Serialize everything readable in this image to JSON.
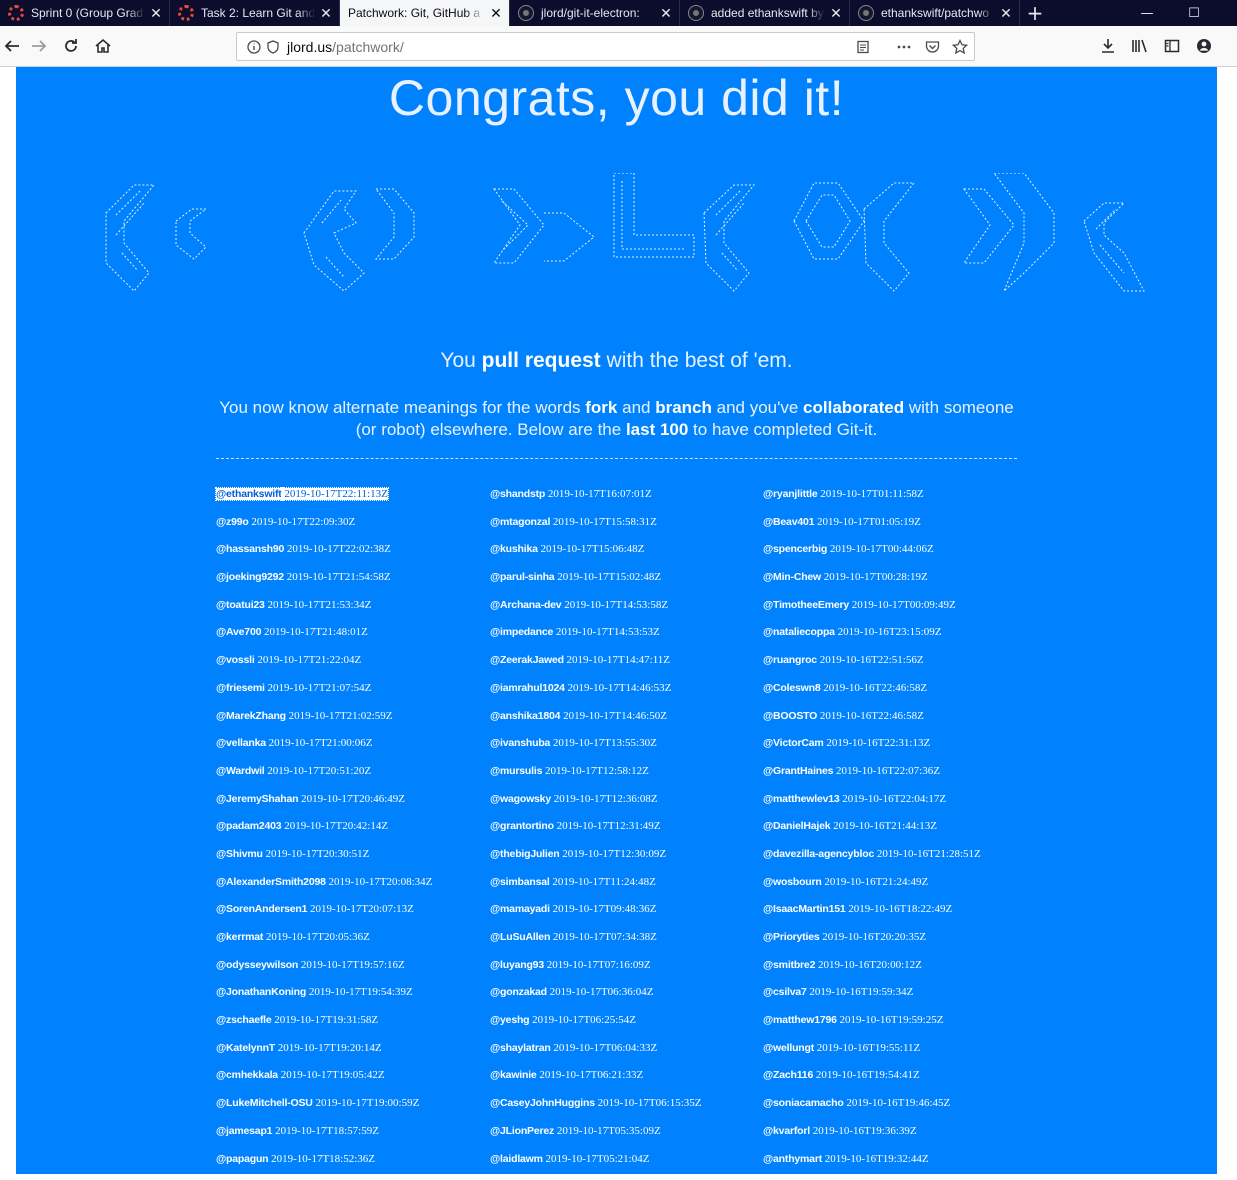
{
  "browser": {
    "tabs": [
      {
        "title": "Sprint 0 (Group Grad",
        "icon": "canvas-icon",
        "active": false
      },
      {
        "title": "Task 2: Learn Git and",
        "icon": "canvas-icon",
        "active": false
      },
      {
        "title": "Patchwork: Git, GitHub a",
        "icon": "none",
        "active": true
      },
      {
        "title": "jlord/git-it-electron:",
        "icon": "github-icon",
        "active": false
      },
      {
        "title": "added ethankswift by",
        "icon": "github-icon",
        "active": false
      },
      {
        "title": "ethankswift/patchwo",
        "icon": "github-icon",
        "active": false
      }
    ],
    "url_domain": "jlord.us",
    "url_path": "/patchwork/",
    "tab_close_glyph": "✕",
    "new_tab_glyph": "+",
    "window_glyphs": {
      "minimize": "—",
      "maximize": "☐"
    }
  },
  "page": {
    "hero": "Congrats, you did it!",
    "tagline": {
      "pre": "You ",
      "bold": "pull request",
      "post": " with the best of 'em."
    },
    "intro": {
      "p1": "You now know alternate meanings for the words ",
      "b1": "fork",
      "p2": " and ",
      "b2": "branch",
      "p3": " and you've ",
      "b3": "collaborated",
      "p4": " with someone (or robot) elsewhere. Below are the ",
      "b4": "last 100",
      "p5": " to have completed Git-it."
    },
    "ascii_art_color": "#e6f0ff",
    "background_color": "#0082ff"
  },
  "entries": {
    "col1": [
      {
        "user": "@ethankswift",
        "time": "2019-10-17T22:11:13Z"
      },
      {
        "user": "@z99o",
        "time": "2019-10-17T22:09:30Z"
      },
      {
        "user": "@hassansh90",
        "time": "2019-10-17T22:02:38Z"
      },
      {
        "user": "@joeking9292",
        "time": "2019-10-17T21:54:58Z"
      },
      {
        "user": "@toatui23",
        "time": "2019-10-17T21:53:34Z"
      },
      {
        "user": "@Ave700",
        "time": "2019-10-17T21:48:01Z"
      },
      {
        "user": "@vossli",
        "time": "2019-10-17T21:22:04Z"
      },
      {
        "user": "@friesemi",
        "time": "2019-10-17T21:07:54Z"
      },
      {
        "user": "@MarekZhang",
        "time": "2019-10-17T21:02:59Z"
      },
      {
        "user": "@vellanka",
        "time": "2019-10-17T21:00:06Z"
      },
      {
        "user": "@Wardwil",
        "time": "2019-10-17T20:51:20Z"
      },
      {
        "user": "@JeremyShahan",
        "time": "2019-10-17T20:46:49Z"
      },
      {
        "user": "@padam2403",
        "time": "2019-10-17T20:42:14Z"
      },
      {
        "user": "@Shivmu",
        "time": "2019-10-17T20:30:51Z"
      },
      {
        "user": "@AlexanderSmith2098",
        "time": "2019-10-17T20:08:34Z"
      },
      {
        "user": "@SorenAndersen1",
        "time": "2019-10-17T20:07:13Z"
      },
      {
        "user": "@kerrmat",
        "time": "2019-10-17T20:05:36Z"
      },
      {
        "user": "@odysseywilson",
        "time": "2019-10-17T19:57:16Z"
      },
      {
        "user": "@JonathanKoning",
        "time": "2019-10-17T19:54:39Z"
      },
      {
        "user": "@zschaefle",
        "time": "2019-10-17T19:31:58Z"
      },
      {
        "user": "@KatelynnT",
        "time": "2019-10-17T19:20:14Z"
      },
      {
        "user": "@cmhekkala",
        "time": "2019-10-17T19:05:42Z"
      },
      {
        "user": "@LukeMitchell-OSU",
        "time": "2019-10-17T19:00:59Z"
      },
      {
        "user": "@jamesap1",
        "time": "2019-10-17T18:57:59Z"
      },
      {
        "user": "@papagun",
        "time": "2019-10-17T18:52:36Z"
      }
    ],
    "col2": [
      {
        "user": "@shandstp",
        "time": "2019-10-17T16:07:01Z"
      },
      {
        "user": "@mtagonzal",
        "time": "2019-10-17T15:58:31Z"
      },
      {
        "user": "@kushika",
        "time": "2019-10-17T15:06:48Z"
      },
      {
        "user": "@parul-sinha",
        "time": "2019-10-17T15:02:48Z"
      },
      {
        "user": "@Archana-dev",
        "time": "2019-10-17T14:53:58Z"
      },
      {
        "user": "@impedance",
        "time": "2019-10-17T14:53:53Z"
      },
      {
        "user": "@ZeerakJawed",
        "time": "2019-10-17T14:47:11Z"
      },
      {
        "user": "@iamrahul1024",
        "time": "2019-10-17T14:46:53Z"
      },
      {
        "user": "@anshika1804",
        "time": "2019-10-17T14:46:50Z"
      },
      {
        "user": "@ivanshuba",
        "time": "2019-10-17T13:55:30Z"
      },
      {
        "user": "@mursulis",
        "time": "2019-10-17T12:58:12Z"
      },
      {
        "user": "@wagowsky",
        "time": "2019-10-17T12:36:08Z"
      },
      {
        "user": "@grantortino",
        "time": "2019-10-17T12:31:49Z"
      },
      {
        "user": "@thebigJulien",
        "time": "2019-10-17T12:30:09Z"
      },
      {
        "user": "@simbansal",
        "time": "2019-10-17T11:24:48Z"
      },
      {
        "user": "@mamayadi",
        "time": "2019-10-17T09:48:36Z"
      },
      {
        "user": "@LuSuAllen",
        "time": "2019-10-17T07:34:38Z"
      },
      {
        "user": "@luyang93",
        "time": "2019-10-17T07:16:09Z"
      },
      {
        "user": "@gonzakad",
        "time": "2019-10-17T06:36:04Z"
      },
      {
        "user": "@yeshg",
        "time": "2019-10-17T06:25:54Z"
      },
      {
        "user": "@shaylatran",
        "time": "2019-10-17T06:04:33Z"
      },
      {
        "user": "@kawinie",
        "time": "2019-10-17T06:21:33Z"
      },
      {
        "user": "@CaseyJohnHuggins",
        "time": "2019-10-17T06:15:35Z"
      },
      {
        "user": "@JLionPerez",
        "time": "2019-10-17T05:35:09Z"
      },
      {
        "user": "@laidlawm",
        "time": "2019-10-17T05:21:04Z"
      }
    ],
    "col3": [
      {
        "user": "@ryanjlittle",
        "time": "2019-10-17T01:11:58Z"
      },
      {
        "user": "@Beav401",
        "time": "2019-10-17T01:05:19Z"
      },
      {
        "user": "@spencerbig",
        "time": "2019-10-17T00:44:06Z"
      },
      {
        "user": "@Min-Chew",
        "time": "2019-10-17T00:28:19Z"
      },
      {
        "user": "@TimotheeEmery",
        "time": "2019-10-17T00:09:49Z"
      },
      {
        "user": "@nataliecoppa",
        "time": "2019-10-16T23:15:09Z"
      },
      {
        "user": "@ruangroc",
        "time": "2019-10-16T22:51:56Z"
      },
      {
        "user": "@Coleswn8",
        "time": "2019-10-16T22:46:58Z"
      },
      {
        "user": "@BOOSTO",
        "time": "2019-10-16T22:46:58Z"
      },
      {
        "user": "@VictorCam",
        "time": "2019-10-16T22:31:13Z"
      },
      {
        "user": "@GrantHaines",
        "time": "2019-10-16T22:07:36Z"
      },
      {
        "user": "@matthewlev13",
        "time": "2019-10-16T22:04:17Z"
      },
      {
        "user": "@DanielHajek",
        "time": "2019-10-16T21:44:13Z"
      },
      {
        "user": "@davezilla-agencybloc",
        "time": "2019-10-16T21:28:51Z"
      },
      {
        "user": "@wosbourn",
        "time": "2019-10-16T21:24:49Z"
      },
      {
        "user": "@IsaacMartin151",
        "time": "2019-10-16T18:22:49Z"
      },
      {
        "user": "@Prioryties",
        "time": "2019-10-16T20:20:35Z"
      },
      {
        "user": "@smitbre2",
        "time": "2019-10-16T20:00:12Z"
      },
      {
        "user": "@csilva7",
        "time": "2019-10-16T19:59:34Z"
      },
      {
        "user": "@matthew1796",
        "time": "2019-10-16T19:59:25Z"
      },
      {
        "user": "@wellungt",
        "time": "2019-10-16T19:55:11Z"
      },
      {
        "user": "@Zach116",
        "time": "2019-10-16T19:54:41Z"
      },
      {
        "user": "@soniacamacho",
        "time": "2019-10-16T19:46:45Z"
      },
      {
        "user": "@kvarforl",
        "time": "2019-10-16T19:36:39Z"
      },
      {
        "user": "@anthymart",
        "time": "2019-10-16T19:32:44Z"
      }
    ]
  }
}
